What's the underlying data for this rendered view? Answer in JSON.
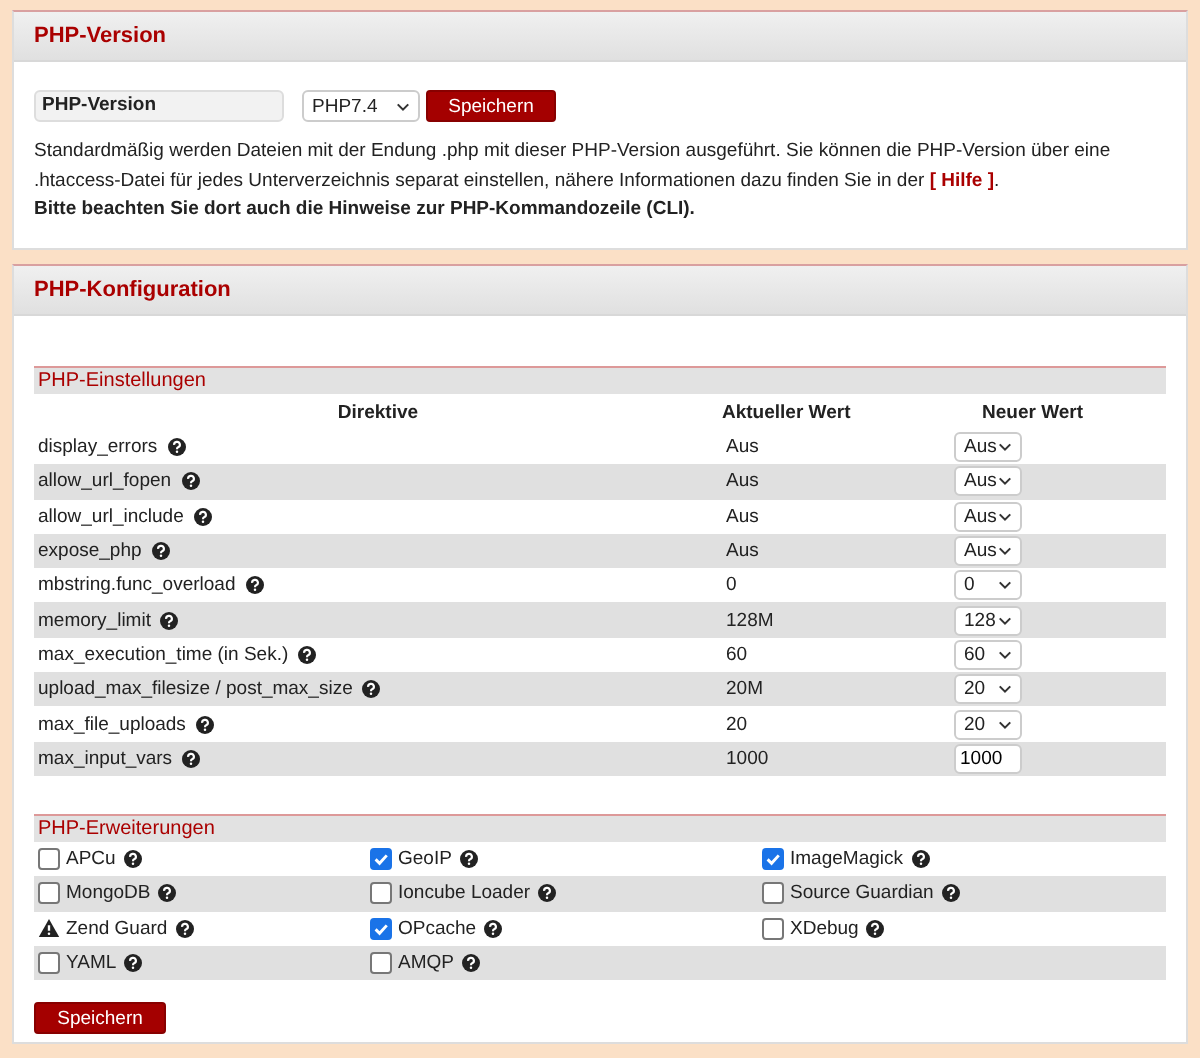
{
  "version_panel": {
    "title": "PHP-Version",
    "field_label": "PHP-Version",
    "select_value": "PHP7.4",
    "save_button": "Speichern",
    "info_text": "Standardmäßig werden Dateien mit der Endung .php mit dieser PHP-Version ausgeführt. Sie können die PHP-Version über eine .htaccess-Datei für jedes Unterverzeichnis separat einstellen, nähere Informationen dazu finden Sie in der ",
    "help_link": "[ Hilfe ]",
    "info_end": ".",
    "note": "Bitte beachten Sie dort auch die Hinweise zur PHP-Kommandozeile (CLI)."
  },
  "config_panel": {
    "title": "PHP-Konfiguration",
    "settings": {
      "title": "PHP-Einstellungen",
      "columns": [
        "Direktive",
        "Aktueller Wert",
        "Neuer Wert"
      ],
      "rows": [
        {
          "directive": "display_errors",
          "current": "Aus",
          "new": "Aus",
          "kind": "select"
        },
        {
          "directive": "allow_url_fopen",
          "current": "Aus",
          "new": "Aus",
          "kind": "select"
        },
        {
          "directive": "allow_url_include",
          "current": "Aus",
          "new": "Aus",
          "kind": "select"
        },
        {
          "directive": "expose_php",
          "current": "Aus",
          "new": "Aus",
          "kind": "select"
        },
        {
          "directive": "mbstring.func_overload",
          "current": "0",
          "new": "0",
          "kind": "select"
        },
        {
          "directive": "memory_limit",
          "current": "128M",
          "new": "128",
          "kind": "select"
        },
        {
          "directive": "max_execution_time (in Sek.)",
          "current": "60",
          "new": "60",
          "kind": "select"
        },
        {
          "directive": "upload_max_filesize / post_max_size",
          "current": "20M",
          "new": "20",
          "kind": "select"
        },
        {
          "directive": "max_file_uploads",
          "current": "20",
          "new": "20",
          "kind": "select"
        },
        {
          "directive": "max_input_vars",
          "current": "1000",
          "new": "1000",
          "kind": "input"
        }
      ]
    },
    "extensions": {
      "title": "PHP-Erweiterungen",
      "rows": [
        [
          {
            "label": "APCu",
            "kind": "checkbox",
            "checked": false
          },
          {
            "label": "GeoIP",
            "kind": "checkbox",
            "checked": true
          },
          {
            "label": "ImageMagick",
            "kind": "checkbox",
            "checked": true
          }
        ],
        [
          {
            "label": "MongoDB",
            "kind": "checkbox",
            "checked": false
          },
          {
            "label": "Ioncube Loader",
            "kind": "checkbox",
            "checked": false
          },
          {
            "label": "Source Guardian",
            "kind": "checkbox",
            "checked": false
          }
        ],
        [
          {
            "label": "Zend Guard",
            "kind": "warning"
          },
          {
            "label": "OPcache",
            "kind": "checkbox",
            "checked": true
          },
          {
            "label": "XDebug",
            "kind": "checkbox",
            "checked": false
          }
        ],
        [
          {
            "label": "YAML",
            "kind": "checkbox",
            "checked": false
          },
          {
            "label": "AMQP",
            "kind": "checkbox",
            "checked": false
          }
        ]
      ]
    },
    "save_button": "Speichern"
  }
}
